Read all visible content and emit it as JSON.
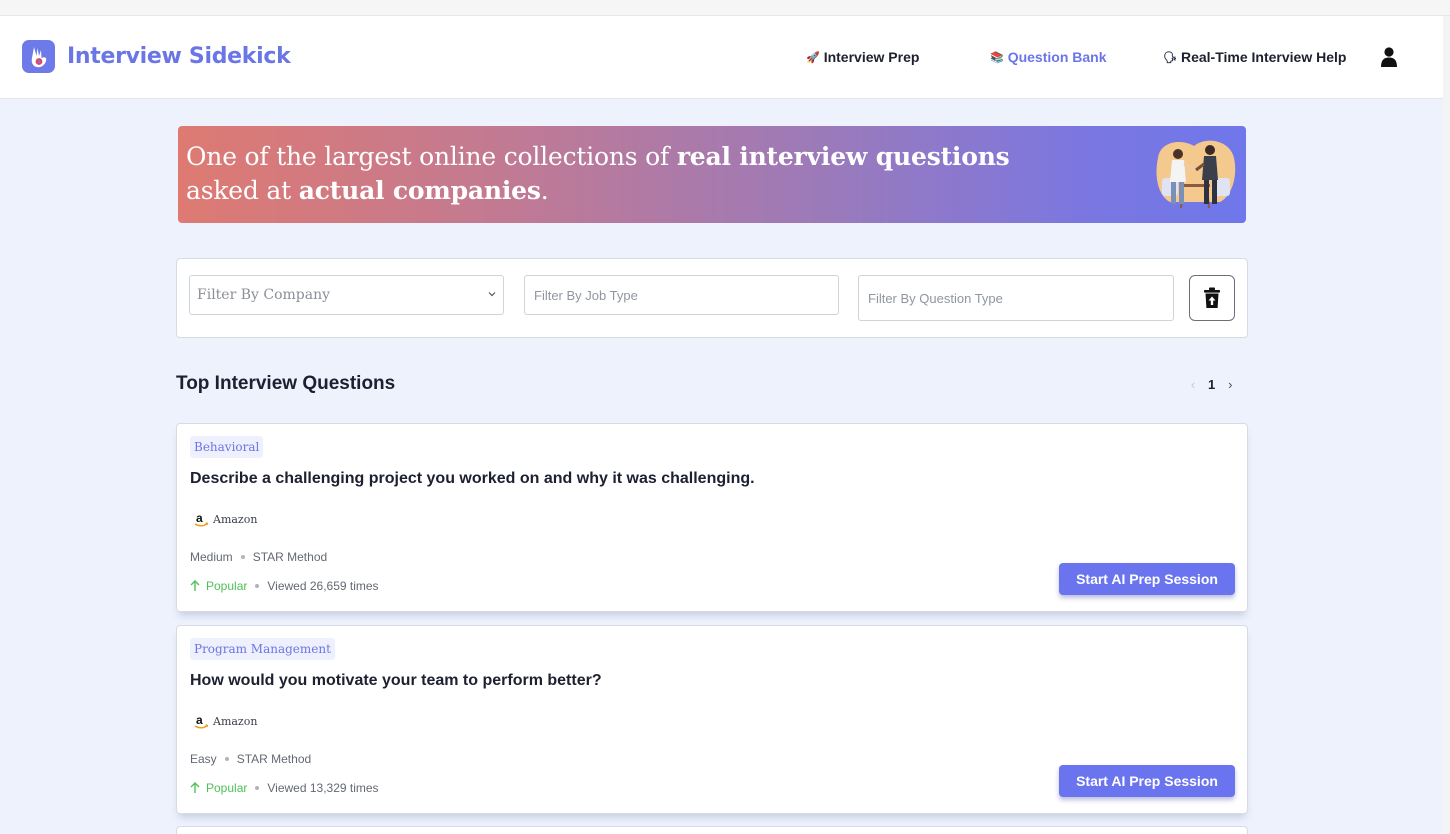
{
  "header": {
    "brand_name": "Interview Sidekick",
    "nav": [
      {
        "label": "Interview Prep",
        "icon": "rocket-icon",
        "active": false
      },
      {
        "label": "Question Bank",
        "icon": "books-icon",
        "active": true
      },
      {
        "label": "Real-Time Interview Help",
        "icon": "speaking-head-icon",
        "active": false
      }
    ],
    "user_icon": "user-icon"
  },
  "banner": {
    "line1_prefix": "One of the largest online collections of ",
    "line1_bold": "real interview questions",
    "line2_prefix": "asked at ",
    "line2_bold": "actual companies",
    "line2_suffix": "."
  },
  "filters": {
    "company_placeholder": "Filter By Company",
    "job_type_placeholder": "Filter By Job Type",
    "question_type_placeholder": "Filter By Question Type",
    "clear_icon": "trash-icon"
  },
  "section": {
    "title": "Top Interview Questions",
    "pager": {
      "prev": "‹",
      "current": "1",
      "next": "›"
    }
  },
  "questions": [
    {
      "tag": "Behavioral",
      "text": "Describe a challenging project you worked on and why it was challenging.",
      "company": "Amazon",
      "difficulty": "Medium",
      "method": "STAR Method",
      "popular_label": "Popular",
      "views": "Viewed 26,659 times",
      "button": "Start AI Prep Session"
    },
    {
      "tag": "Program Management",
      "text": "How would you motivate your team to perform better?",
      "company": "Amazon",
      "difficulty": "Easy",
      "method": "STAR Method",
      "popular_label": "Popular",
      "views": "Viewed 13,329 times",
      "button": "Start AI Prep Session"
    }
  ],
  "colors": {
    "accent": "#6b76e6",
    "button": "#6b74ef",
    "popular": "#4fc15a",
    "page_bg": "#edf2fd"
  }
}
